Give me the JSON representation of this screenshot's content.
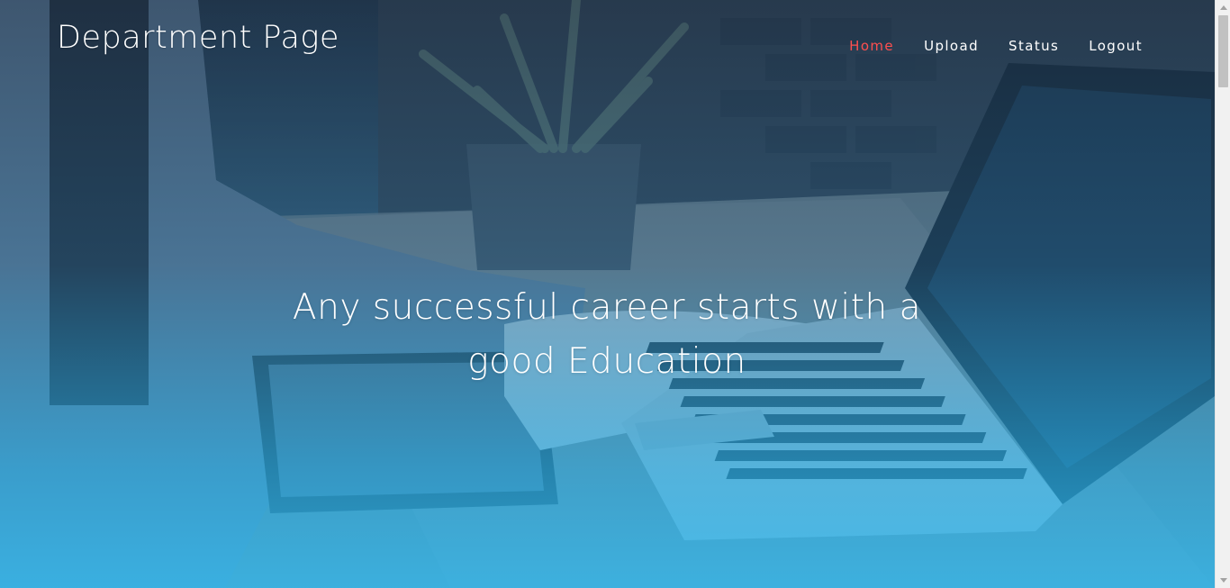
{
  "header": {
    "brand": "Department Page",
    "nav": [
      {
        "label": "Home",
        "active": true
      },
      {
        "label": "Upload",
        "active": false
      },
      {
        "label": "Status",
        "active": false
      },
      {
        "label": "Logout",
        "active": false
      }
    ]
  },
  "hero": {
    "headline_line1": "Any successful career starts with a",
    "headline_line2": "good Education",
    "background": "person-typing-on-laptop-photo"
  },
  "colors": {
    "active_nav": "#ff4f4f",
    "text": "#ffffff",
    "overlay_top": "#1c2c44",
    "overlay_bottom": "#30b6eb"
  },
  "icons": {
    "scroll_up": "chevron-up-icon",
    "scroll_down": "chevron-down-icon"
  }
}
